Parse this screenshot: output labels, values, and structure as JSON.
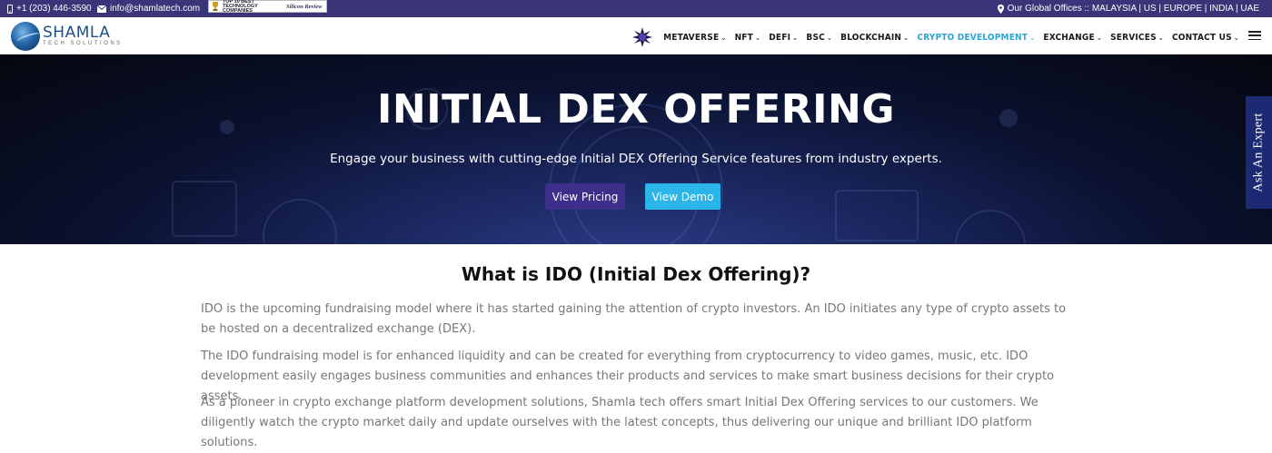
{
  "topbar": {
    "phone": "+1 (203) 446-3590",
    "email": "info@shamlatech.com",
    "badge_left": "TOP 10 BEST TECHNOLOGY COMPANIES",
    "badge_right": "Silicon Review",
    "offices": "Our Global Offices :: MALAYSIA | US | EUROPE | INDIA | UAE"
  },
  "logo": {
    "brand": "SHAMLA",
    "sub": "TECH SOLUTIONS"
  },
  "nav": {
    "items": [
      {
        "label": "METAVERSE"
      },
      {
        "label": "NFT"
      },
      {
        "label": "DEFI"
      },
      {
        "label": "BSC"
      },
      {
        "label": "BLOCKCHAIN"
      },
      {
        "label": "CRYPTO DEVELOPMENT"
      },
      {
        "label": "EXCHANGE"
      },
      {
        "label": "SERVICES"
      },
      {
        "label": "CONTACT US"
      }
    ],
    "active_color": "#2aa6d6"
  },
  "hero": {
    "title": "INITIAL DEX OFFERING",
    "tagline": "Engage your business with cutting-edge Initial DEX Offering Service features from industry experts.",
    "pricing_label": "View Pricing",
    "demo_label": "View Demo",
    "pricing_color": "#3d2f8a",
    "demo_color": "#2bb5e8"
  },
  "ask_expert": "Ask An Expert",
  "content": {
    "heading": "What is IDO (Initial Dex Offering)?",
    "paragraphs": [
      "IDO is the upcoming fundraising model where it has started gaining the attention of crypto investors. An IDO initiates any type of crypto assets to be hosted on a decentralized exchange (DEX).",
      "The IDO fundraising model is for enhanced liquidity and can be created for everything from cryptocurrency to video games, music, etc. IDO development easily engages business communities and enhances their products and services to make smart business decisions for their crypto assets.",
      "As a pioneer in crypto exchange platform development solutions, Shamla tech offers smart Initial Dex Offering services to our customers. We diligently watch the crypto market daily and update ourselves with the latest concepts, thus delivering our unique and brilliant IDO platform solutions."
    ]
  },
  "icons": {
    "phone": "phone-icon",
    "email": "envelope-icon",
    "offices": "map-marker-icon",
    "nav_chevron": "chevron-down-icon",
    "menu": "hamburger-icon"
  }
}
